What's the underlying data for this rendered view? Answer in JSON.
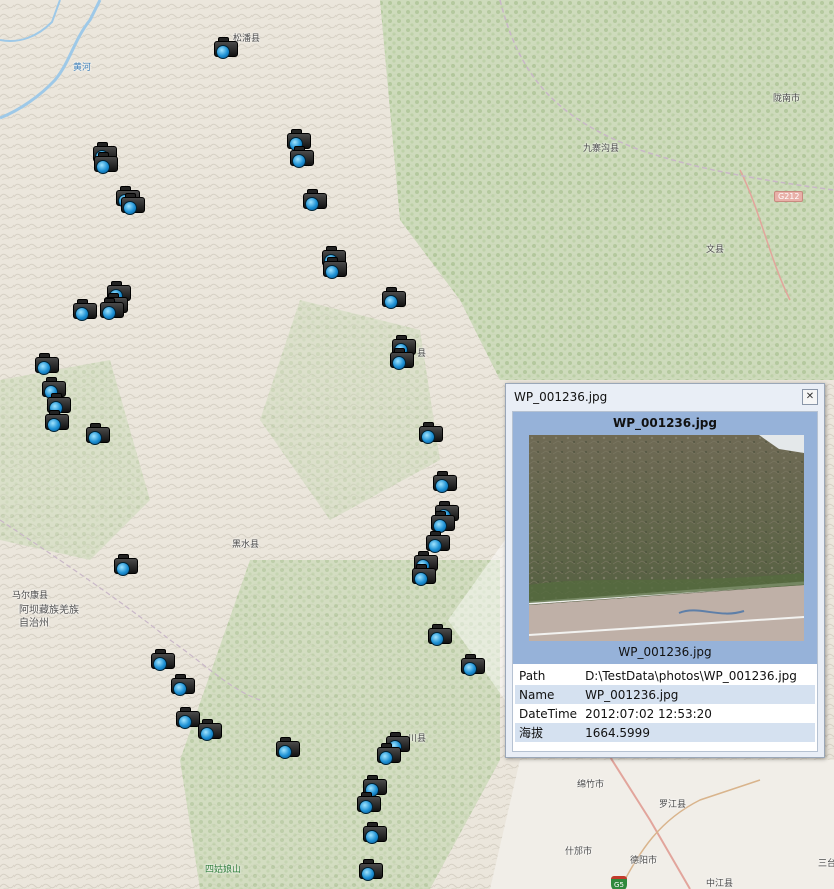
{
  "map": {
    "places": [
      {
        "id": "songpan-top",
        "label": "松潘县"
      },
      {
        "id": "huanghe",
        "label": "黄河",
        "river": true
      },
      {
        "id": "longnan",
        "label": "陇南市"
      },
      {
        "id": "jiuzhaigou",
        "label": "九寨沟县"
      },
      {
        "id": "wenxian",
        "label": "文县"
      },
      {
        "id": "heishui",
        "label": "黑水县"
      },
      {
        "id": "maerkang",
        "label": "马尔康县"
      },
      {
        "id": "aba",
        "label": "阿坝藏族羌族\n自治州",
        "aut": true
      },
      {
        "id": "maoxian",
        "label": "县"
      },
      {
        "id": "beichuan",
        "label": "川县"
      },
      {
        "id": "mianzhu",
        "label": "绵竹市"
      },
      {
        "id": "luojiang",
        "label": "罗江县"
      },
      {
        "id": "shifang",
        "label": "什邡市"
      },
      {
        "id": "deyang",
        "label": "德阳市"
      },
      {
        "id": "zhongjiang",
        "label": "中江县"
      },
      {
        "id": "sanxian",
        "label": "三台"
      },
      {
        "id": "siguniang",
        "label": "四姑娘山"
      },
      {
        "id": "xian",
        "label": "县"
      }
    ],
    "road_shields": [
      "G212"
    ],
    "highway_shields": [
      "G5"
    ],
    "markers": [
      "photo-marker",
      "photo-marker",
      "photo-marker",
      "photo-marker",
      "photo-marker",
      "photo-marker",
      "photo-marker",
      "photo-marker",
      "photo-marker",
      "photo-marker",
      "photo-marker",
      "photo-marker",
      "photo-marker",
      "photo-marker",
      "photo-marker",
      "photo-marker",
      "photo-marker",
      "photo-marker",
      "photo-marker",
      "photo-marker",
      "photo-marker",
      "photo-marker",
      "photo-marker",
      "photo-marker",
      "photo-marker",
      "photo-marker",
      "photo-marker",
      "photo-marker",
      "photo-marker",
      "photo-marker",
      "photo-marker",
      "photo-marker",
      "photo-marker",
      "photo-marker",
      "photo-marker",
      "photo-marker",
      "photo-marker",
      "photo-marker",
      "photo-marker",
      "photo-marker",
      "photo-marker",
      "photo-marker",
      "photo-marker"
    ],
    "colors": {
      "terrain": "#ece8df",
      "vegetation": "#b8cfa4",
      "water": "#9ec9e8",
      "road": "#e8b0a8"
    }
  },
  "popup": {
    "window_title": "WP_001236.jpg",
    "close_icon": "close-icon",
    "photo_title": "WP_001236.jpg",
    "photo_caption": "WP_001236.jpg",
    "attributes": [
      {
        "key": "Path",
        "value": "D:\\TestData\\photos\\WP_001236.jpg"
      },
      {
        "key": "Name",
        "value": "WP_001236.jpg"
      },
      {
        "key": "DateTime",
        "value": "2012:07:02 12:53:20"
      },
      {
        "key": "海拔",
        "value": "1664.5999"
      }
    ],
    "colors": {
      "panel": "#96b2d9",
      "row_alt": "#d5e1f0"
    }
  }
}
